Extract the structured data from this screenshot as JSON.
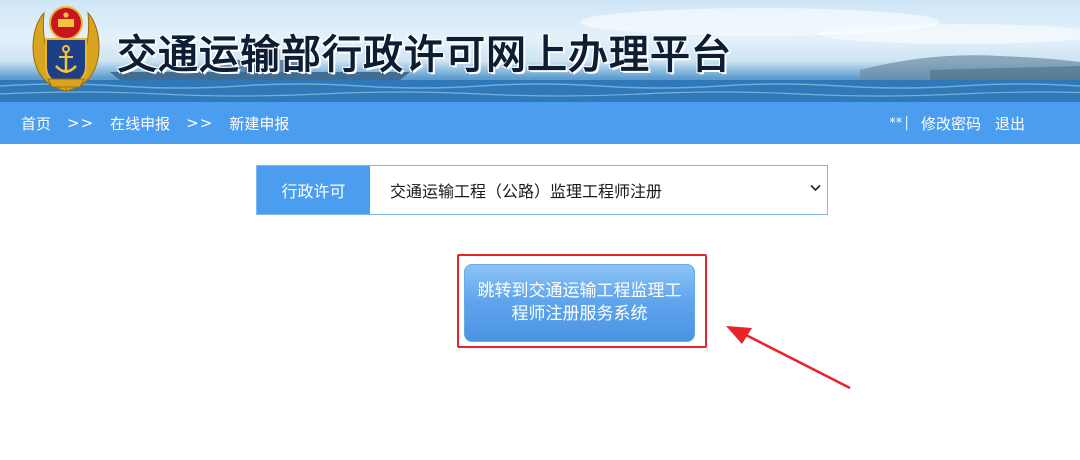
{
  "header": {
    "title": "交通运输部行政许可网上办理平台",
    "emblem_icon": "traffic-police-emblem-icon"
  },
  "nav": {
    "breadcrumb": [
      "首页",
      "在线申报",
      "新建申报"
    ],
    "separator": ">>",
    "user": "**",
    "divider": "|",
    "change_password": "修改密码",
    "logout": "退出"
  },
  "form": {
    "label": "行政许可",
    "selected": "交通运输工程（公路）监理工程师注册"
  },
  "action": {
    "button_label": "跳转到交通运输工程监理工程师注册服务系统"
  },
  "colors": {
    "nav": "#4b9df0",
    "highlight": "#e8232a",
    "button": "#5fa5ec"
  }
}
